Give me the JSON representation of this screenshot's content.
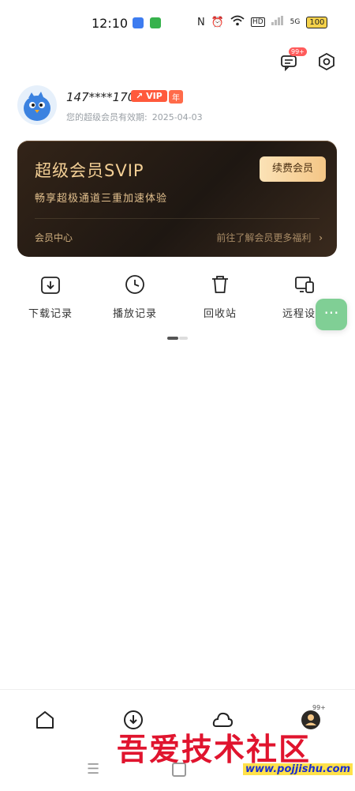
{
  "status_bar": {
    "time": "12:10",
    "network": "5G",
    "battery": "100"
  },
  "header": {
    "message_badge": "99+"
  },
  "profile": {
    "username": "147****170...",
    "vip_label": "VIP",
    "year_label": "年",
    "expire_label": "您的超级会员有效期:",
    "expire_date": "2025-04-03"
  },
  "vip_card": {
    "title": "超级会员SVIP",
    "subtitle": "畅享超极通道三重加速体验",
    "renew_button": "续费会员",
    "center_label": "会员中心",
    "more_benefits": "前往了解会员更多福利"
  },
  "quick_actions": [
    {
      "label": "下载记录",
      "icon": "download-box-icon"
    },
    {
      "label": "播放记录",
      "icon": "clock-icon"
    },
    {
      "label": "回收站",
      "icon": "trash-icon"
    },
    {
      "label": "远程设备",
      "icon": "devices-icon"
    }
  ],
  "fab": {
    "label": "···"
  },
  "bottom_nav": {
    "profile_badge": "99+",
    "items": [
      "home-icon",
      "download-icon",
      "cloud-icon",
      "profile-icon"
    ]
  },
  "watermark": {
    "text": "吾爱技术社区",
    "url": "www.pojjishu.com"
  },
  "colors": {
    "vip_gold": "#f3cf95",
    "vip_card_bg": "#1e1712",
    "fab_green": "#80cf95",
    "vip_tag": "#ff5a3c"
  }
}
